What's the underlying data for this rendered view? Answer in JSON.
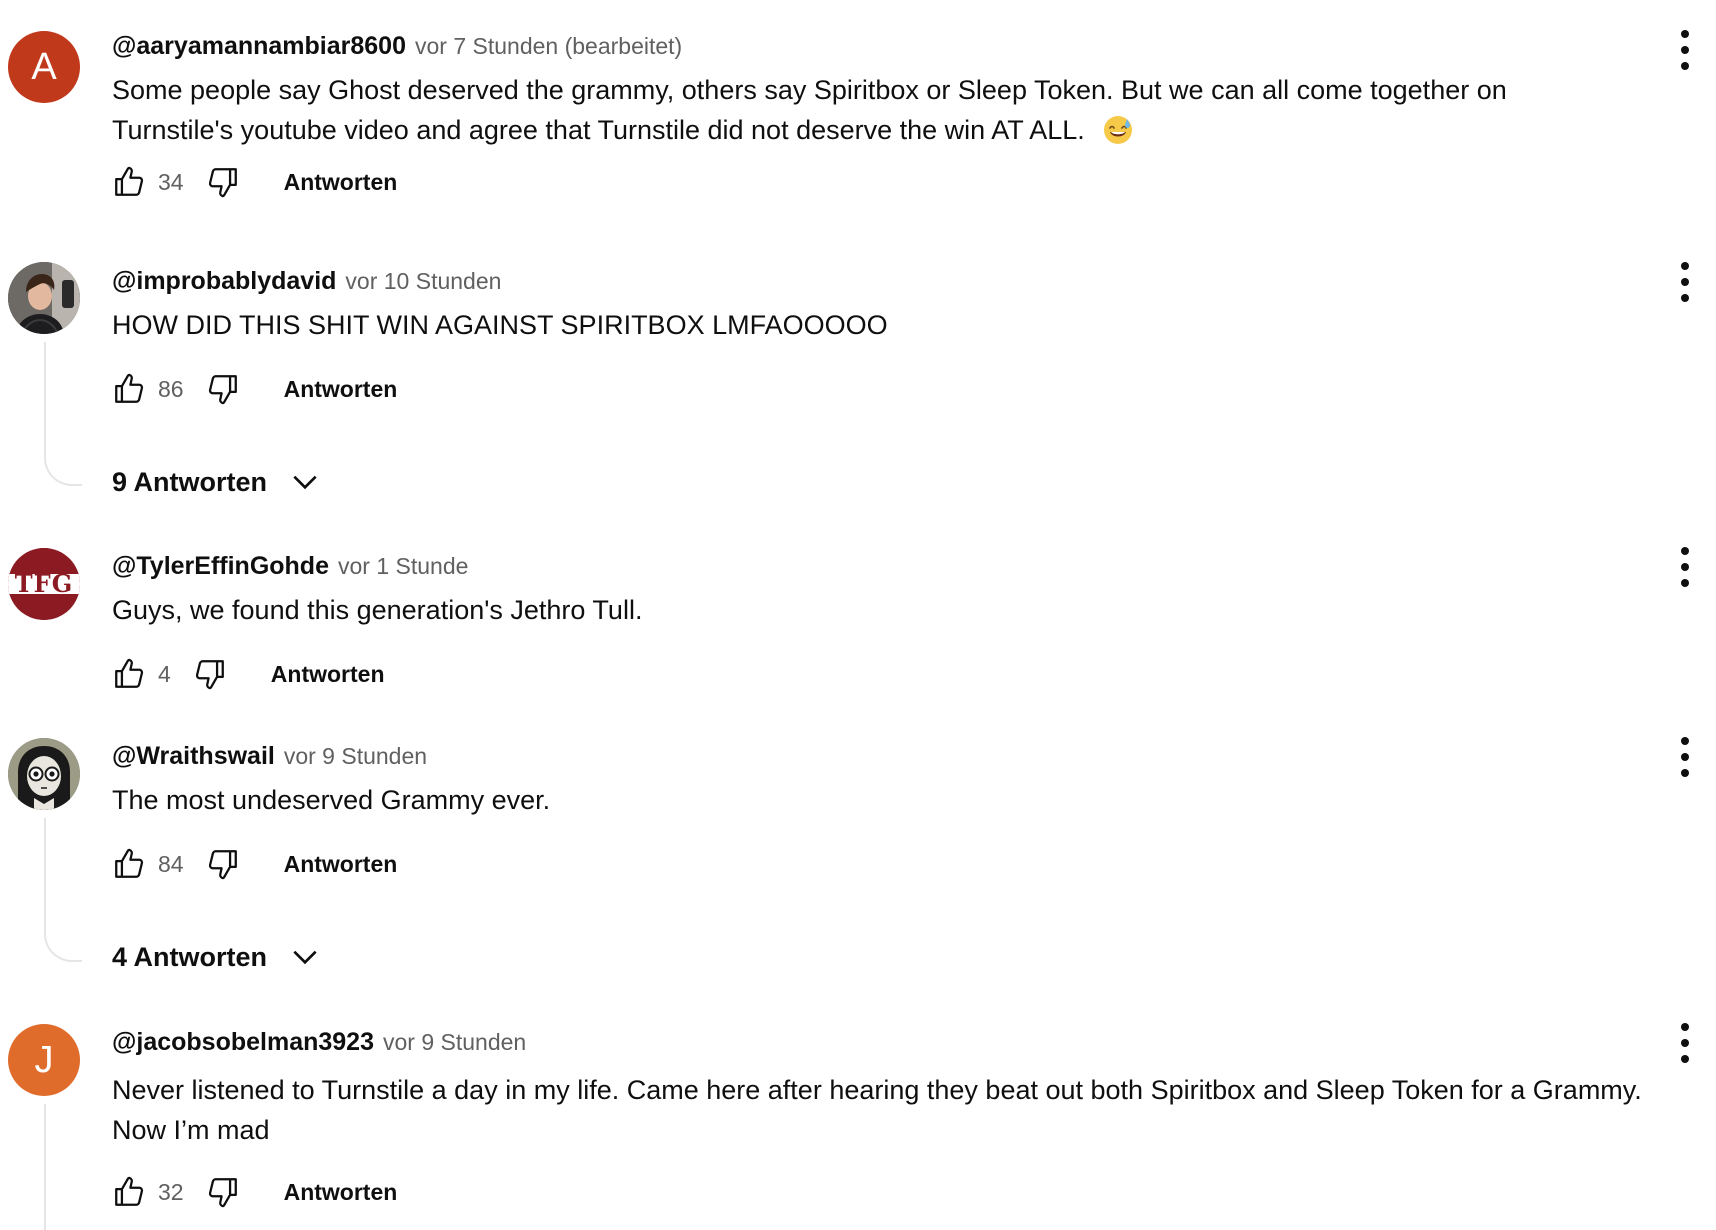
{
  "comments": [
    {
      "avatar_type": "letter",
      "avatar_letter": "A",
      "avatar_color": "#c0391b",
      "author": "@aaryamannambiar8600",
      "time": "vor 7 Stunden (bearbeitet)",
      "text": "Some people say Ghost deserved the grammy, others say Spiritbox or Sleep Token. But we can all come together on Turnstile's youtube video and agree that Turnstile did not deserve the win AT ALL.",
      "emoji": "sweat-smile-emoji",
      "likes": "34",
      "reply_label": "Antworten"
    },
    {
      "avatar_type": "photo",
      "avatar_icon": "person-photo-avatar",
      "author": "@improbablydavid",
      "time": "vor 10 Stunden",
      "text": "HOW DID THIS SHIT WIN AGAINST SPIRITBOX LMFAOOOOO",
      "likes": "86",
      "reply_label": "Antworten",
      "replies_label": "9 Antworten"
    },
    {
      "avatar_type": "logo",
      "avatar_logo_text": "TFG",
      "avatar_color": "#8b1a22",
      "author": "@TylerEffinGohde",
      "time": "vor 1 Stunde",
      "text": "Guys, we found this generation's Jethro Tull.",
      "likes": "4",
      "reply_label": "Antworten"
    },
    {
      "avatar_type": "illustration",
      "avatar_icon": "ghost-girl-avatar",
      "author": "@Wraithswail",
      "time": "vor 9 Stunden",
      "text": "The most undeserved Grammy ever.",
      "likes": "84",
      "reply_label": "Antworten",
      "replies_label": "4 Antworten"
    },
    {
      "avatar_type": "letter",
      "avatar_letter": "J",
      "avatar_color": "#e06c2c",
      "author": "@jacobsobelman3923",
      "time": "vor 9 Stunden",
      "text": "Never listened to Turnstile a day in my life. Came here after hearing they beat out both Spiritbox and Sleep Token for a Grammy. Now I’m mad",
      "likes": "32",
      "reply_label": "Antworten"
    }
  ],
  "icons": {
    "like": "thumbs-up-icon",
    "dislike": "thumbs-down-icon",
    "menu": "more-vert-icon",
    "expand": "chevron-down-icon"
  }
}
